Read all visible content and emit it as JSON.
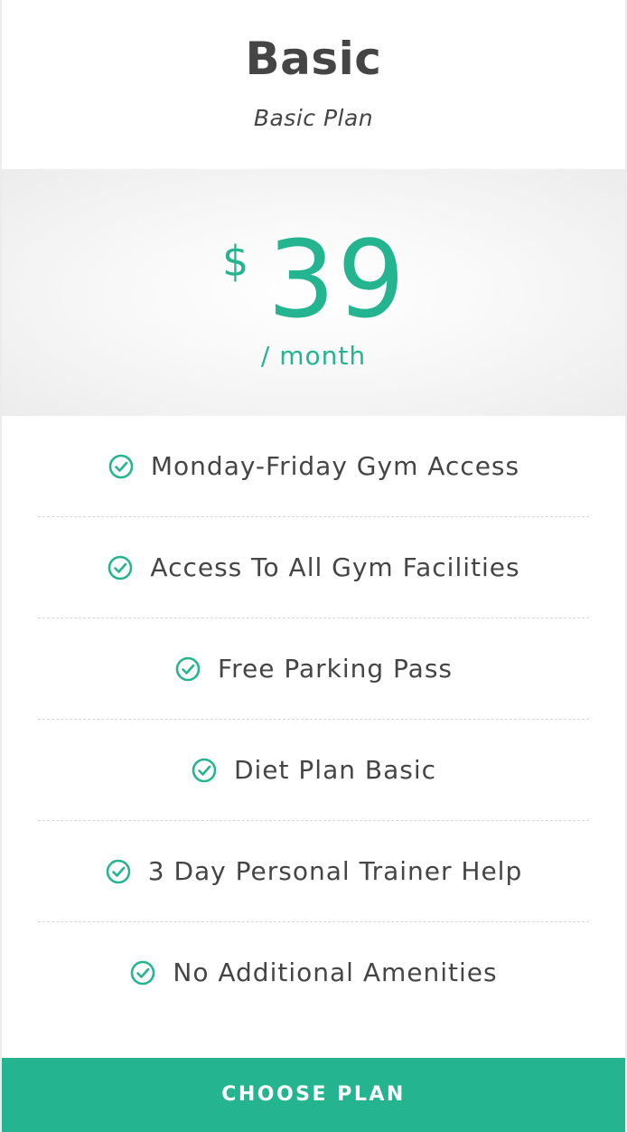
{
  "plan": {
    "name": "Basic",
    "subtitle": "Basic Plan"
  },
  "price": {
    "currency": "$",
    "amount": "39",
    "period": "/ month"
  },
  "features": [
    "Monday-Friday Gym Access",
    "Access To All Gym Facilities",
    "Free Parking Pass",
    "Diet Plan Basic",
    "3 Day Personal Trainer Help",
    "No Additional Amenities"
  ],
  "feature_icon": "check-circle-icon",
  "cta": {
    "label": "CHOOSE PLAN"
  },
  "colors": {
    "accent": "#24b590",
    "text": "#454545"
  }
}
